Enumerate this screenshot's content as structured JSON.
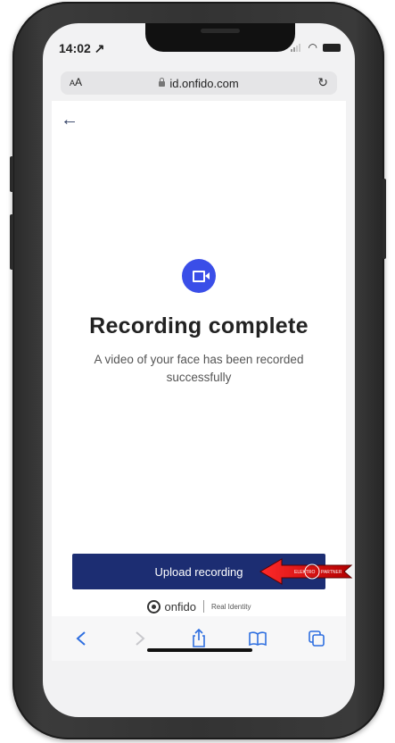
{
  "status_bar": {
    "time": "14:02 ↗"
  },
  "browser": {
    "text_size_button": {
      "small": "A",
      "large": "A"
    },
    "url": "id.onfido.com",
    "reload_icon": "reload-icon"
  },
  "page": {
    "back_icon": "back-arrow-icon",
    "camera_icon": "video-camera-icon",
    "accent_color": "#3a4ee8",
    "title": "Recording complete",
    "subtitle": "A video of your face has been recorded successfully",
    "upload_button": {
      "label": "Upload recording",
      "color": "#1c2d72"
    },
    "overlay_badge": {
      "left": "ELEKTRO",
      "right": "PARTNER"
    }
  },
  "branding": {
    "name": "onfido",
    "tagline": "Real Identity"
  },
  "toolbar": {
    "items": [
      "back-icon",
      "forward-icon",
      "share-icon",
      "bookmarks-icon",
      "tabs-icon"
    ]
  }
}
